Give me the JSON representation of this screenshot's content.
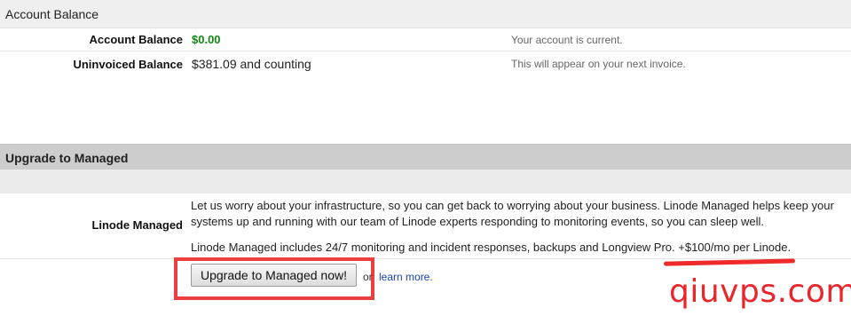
{
  "account_balance_section": {
    "title": "Account Balance",
    "rows": [
      {
        "label": "Account Balance",
        "value": "$0.00",
        "note": "Your account is current."
      },
      {
        "label": "Uninvoiced Balance",
        "value": "$381.09 and counting",
        "note": "This will appear on your next invoice."
      }
    ]
  },
  "managed_section": {
    "title": "Upgrade to Managed",
    "label": "Linode Managed",
    "description_1": "Let us worry about your infrastructure, so you can get back to worrying about your business. Linode Managed helps keep your systems up and running with our team of Linode experts responding to monitoring events, so you can sleep well.",
    "description_2": "Linode Managed includes 24/7 monitoring and incident responses, backups and Longview Pro. +$100/mo per Linode.",
    "upgrade_button": "Upgrade to Managed now!",
    "or_text": "or",
    "learn_more": "learn more."
  },
  "watermark": "qiuvps.com",
  "colors": {
    "balance_green": "#108a10",
    "link_blue": "#1a44b8",
    "highlight_red": "#ec3e3e"
  }
}
